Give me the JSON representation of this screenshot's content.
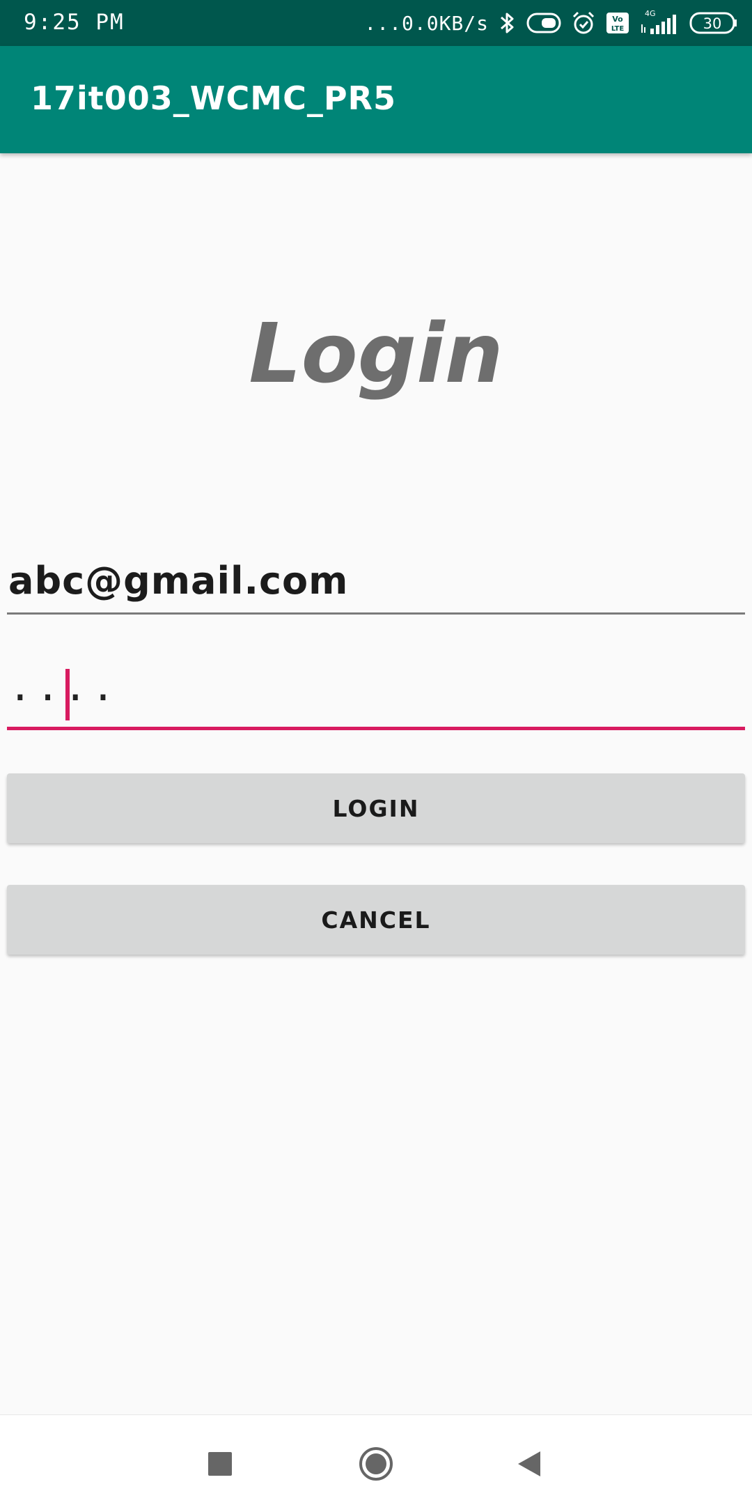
{
  "status_bar": {
    "time": "9:25 PM",
    "net_speed": "...0.0KB/s",
    "network_type": "4G",
    "volte_label_top": "Vo",
    "volte_label_bottom": "LTE",
    "battery": "30",
    "icons": [
      "bluetooth-icon",
      "toggle-icon",
      "alarm-icon",
      "volte-icon",
      "signal-icon",
      "battery-icon"
    ]
  },
  "app_bar": {
    "title": "17it003_WCMC_PR5",
    "color": "#008577"
  },
  "login": {
    "heading": "Login",
    "email_value": "abc@gmail.com",
    "password_value": "....",
    "login_button": "LOGIN",
    "cancel_button": "CANCEL",
    "accent_color": "#d81b60"
  },
  "nav_bar": {
    "icons": [
      "recent-apps-icon",
      "home-icon",
      "back-icon"
    ]
  }
}
